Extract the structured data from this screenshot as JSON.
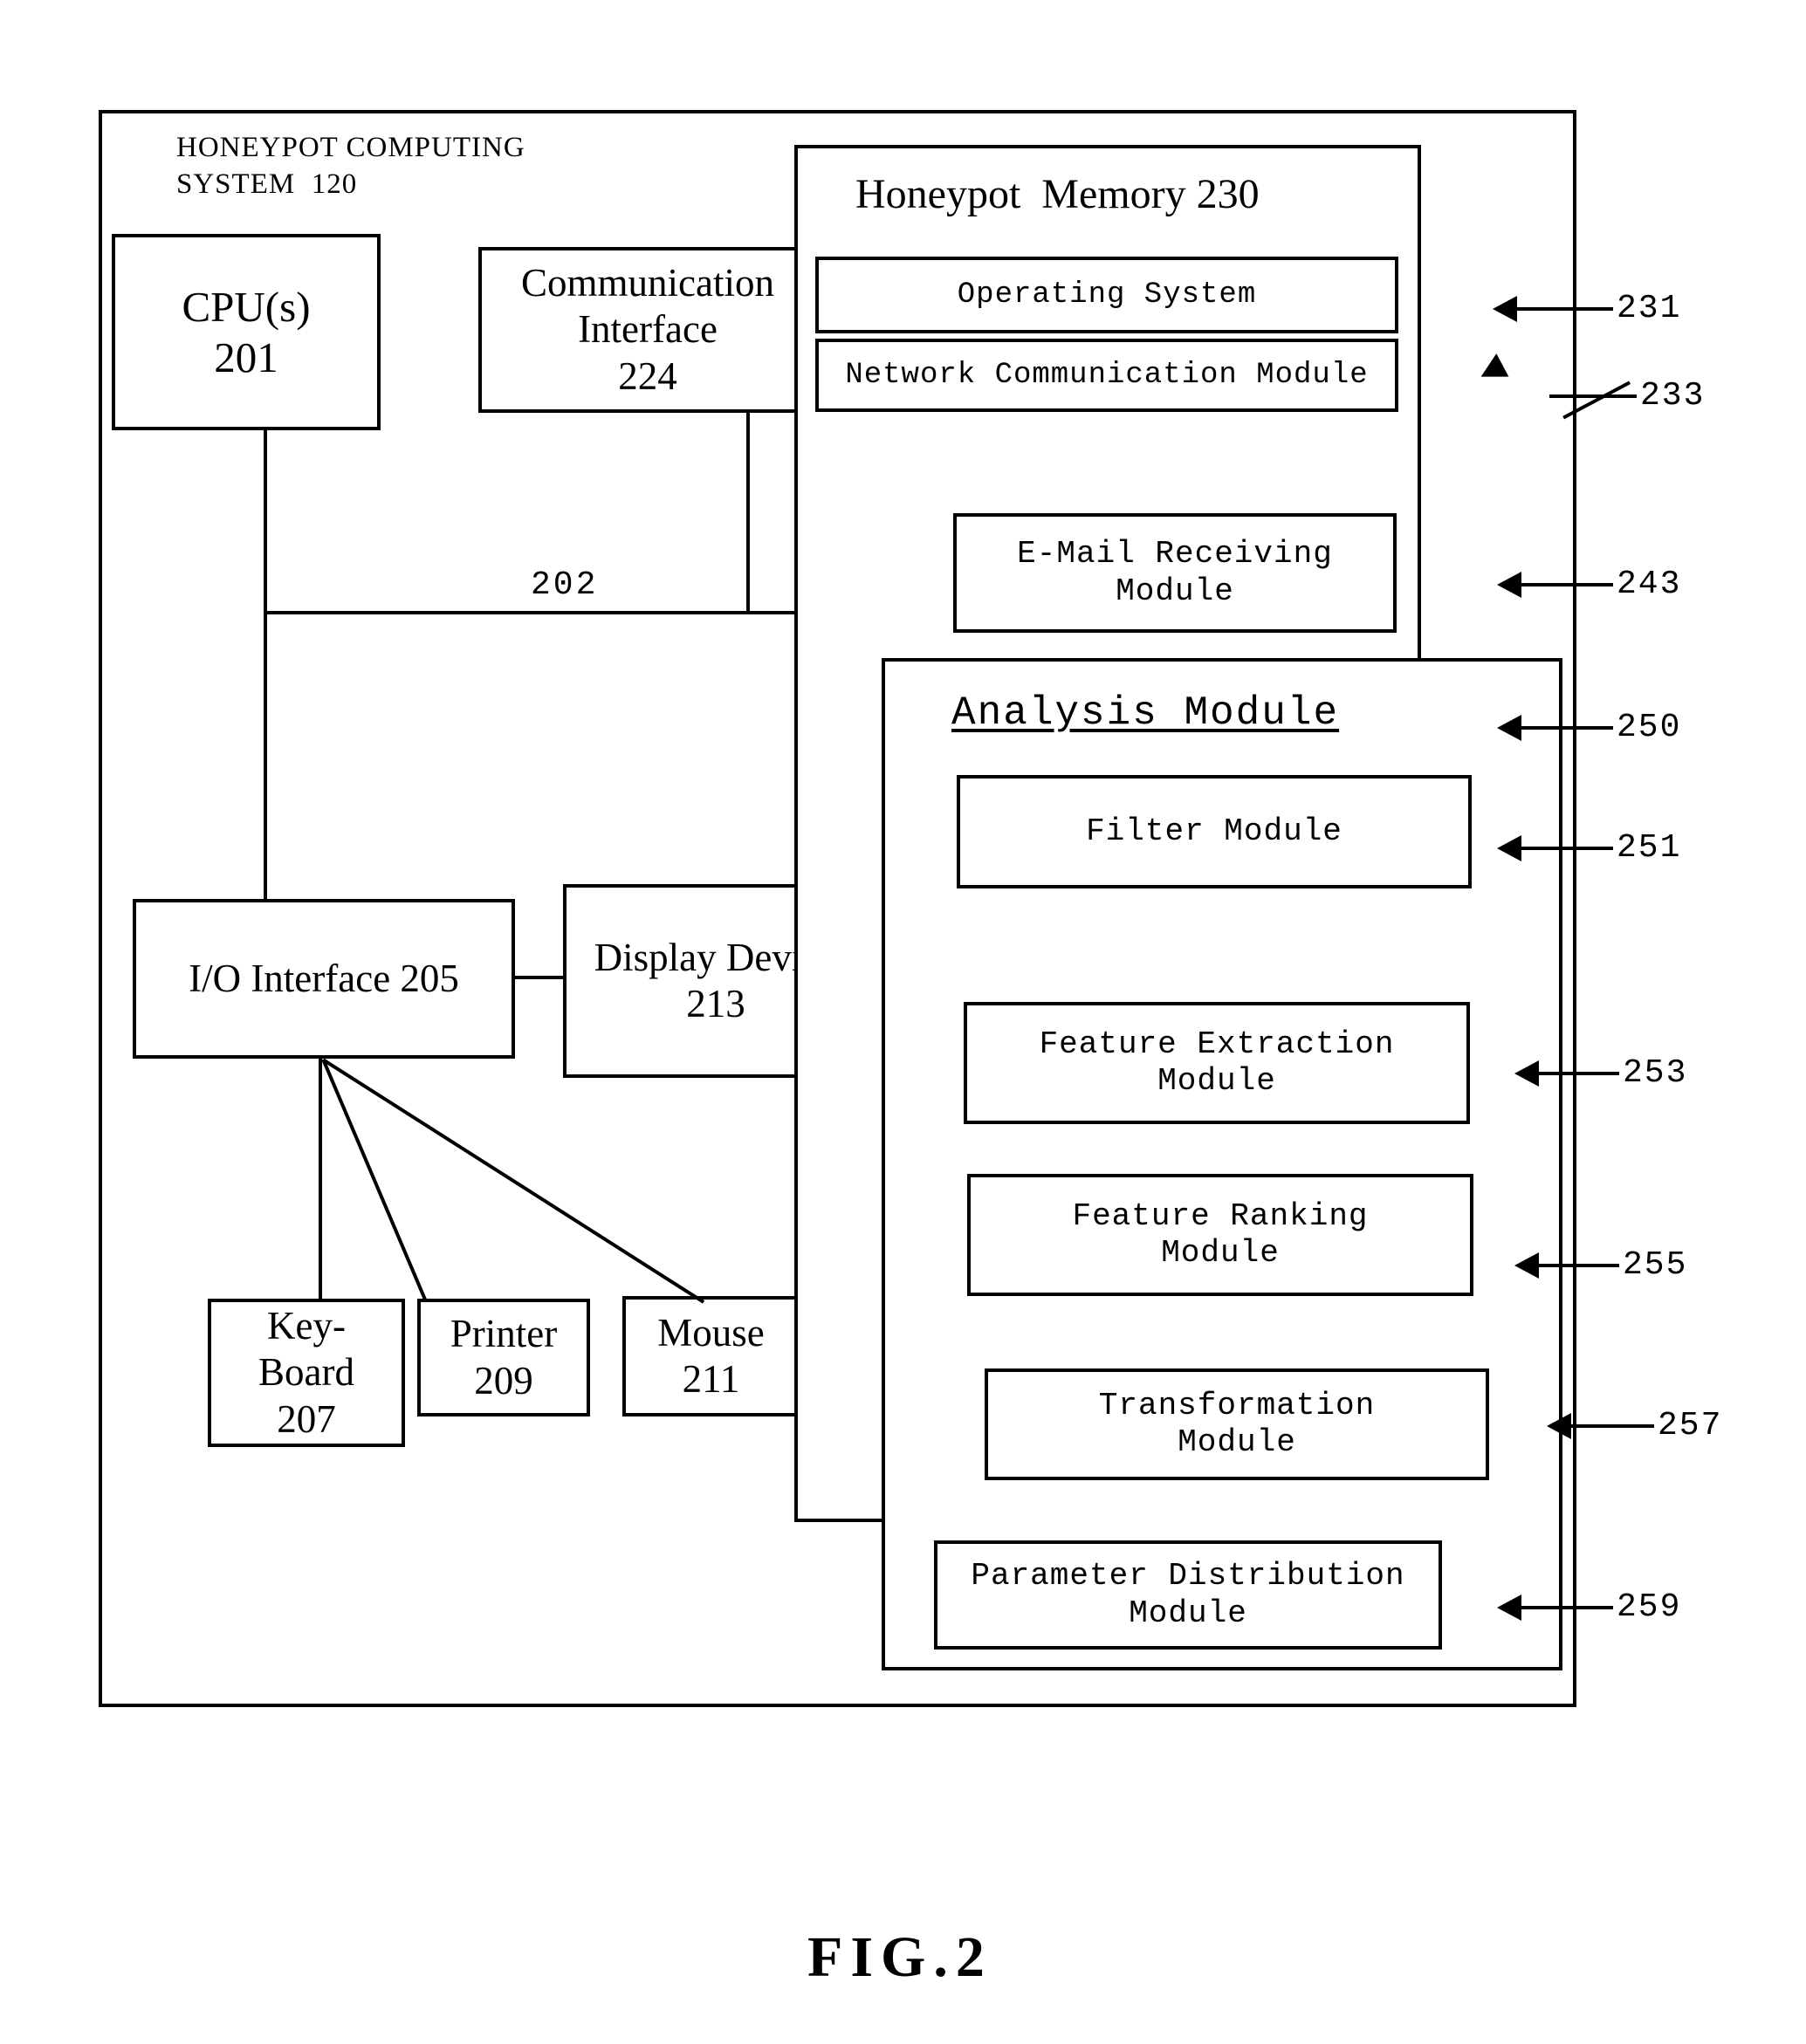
{
  "figure": {
    "caption": "FIG.2",
    "outer_system": {
      "title_line1": "HONEYPOT COMPUTING",
      "title_line2": "SYSTEM  120"
    },
    "bus_label": "202",
    "hardware": [
      {
        "id": "cpu",
        "line1": "CPU(s)",
        "line2": "201"
      },
      {
        "id": "communication-interface",
        "line1": "Communication",
        "line2": "Interface",
        "line3": "224"
      },
      {
        "id": "io-interface",
        "line1": "I/O Interface 205"
      },
      {
        "id": "display-device",
        "line1": "Display Device",
        "line2": "213"
      },
      {
        "id": "keyboard",
        "line1": "Key-",
        "line2": "Board",
        "line3": "207"
      },
      {
        "id": "printer",
        "line1": "Printer",
        "line2": "209"
      },
      {
        "id": "mouse",
        "line1": "Mouse",
        "line2": "211"
      }
    ],
    "memory": {
      "title": "Honeypot  Memory 230",
      "modules": [
        {
          "id": "operating-system",
          "line1": "Operating System",
          "ref": "231"
        },
        {
          "id": "network-communication-module",
          "line1": "Network Communication Module",
          "ref": "233"
        },
        {
          "id": "email-receiving-module",
          "line1": "E-Mail Receiving",
          "line2": "Module",
          "ref": "243"
        }
      ],
      "analysis_module": {
        "title": "Analysis Module",
        "ref": "250",
        "submodules": [
          {
            "id": "filter-module",
            "line1": "Filter Module",
            "ref": "251"
          },
          {
            "id": "feature-extraction-module",
            "line1": "Feature Extraction",
            "line2": "Module",
            "ref": "253"
          },
          {
            "id": "feature-ranking-module",
            "line1": "Feature Ranking",
            "line2": "Module",
            "ref": "255"
          },
          {
            "id": "transformation-module",
            "line1": "Transformation",
            "line2": "Module",
            "ref": "257"
          },
          {
            "id": "parameter-distribution-module",
            "line1": "Parameter Distribution",
            "line2": "Module",
            "ref": "259"
          }
        ]
      }
    }
  }
}
